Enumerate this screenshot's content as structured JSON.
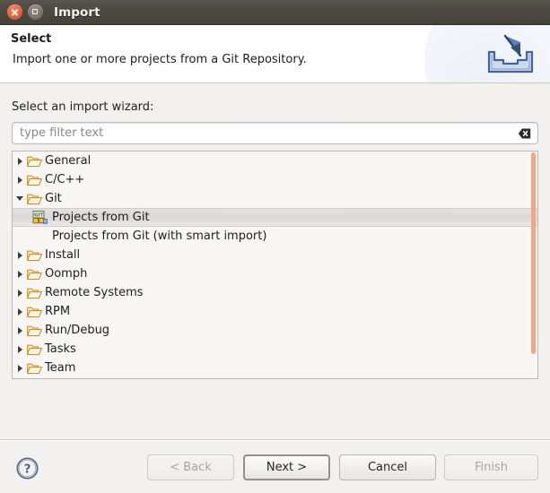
{
  "window": {
    "title": "Import",
    "close_icon": "window-close-icon",
    "maximize_icon": "window-maximize-icon"
  },
  "header": {
    "title": "Select",
    "description": "Import one or more projects from a Git Repository.",
    "icon": "import-wizard-icon"
  },
  "body": {
    "wizard_label": "Select an import wizard:"
  },
  "filter": {
    "placeholder": "type filter text",
    "value": "",
    "clear_icon": "clear-filter-icon"
  },
  "tree": {
    "rows": [
      {
        "label": "General",
        "type": "folder",
        "expanded": false,
        "selected": false
      },
      {
        "label": "C/C++",
        "type": "folder",
        "expanded": false,
        "selected": false
      },
      {
        "label": "Git",
        "type": "folder",
        "expanded": true,
        "selected": false
      },
      {
        "label": "Projects from Git",
        "type": "git",
        "expanded": null,
        "selected": true
      },
      {
        "label": "Projects from Git (with smart import)",
        "type": "leaf",
        "expanded": null,
        "selected": false
      },
      {
        "label": "Install",
        "type": "folder",
        "expanded": false,
        "selected": false
      },
      {
        "label": "Oomph",
        "type": "folder",
        "expanded": false,
        "selected": false
      },
      {
        "label": "Remote Systems",
        "type": "folder",
        "expanded": false,
        "selected": false
      },
      {
        "label": "RPM",
        "type": "folder",
        "expanded": false,
        "selected": false
      },
      {
        "label": "Run/Debug",
        "type": "folder",
        "expanded": false,
        "selected": false
      },
      {
        "label": "Tasks",
        "type": "folder",
        "expanded": false,
        "selected": false
      },
      {
        "label": "Team",
        "type": "folder",
        "expanded": false,
        "selected": false
      }
    ],
    "scrollbar_color": "#eda88c"
  },
  "footer": {
    "help_icon": "help-icon",
    "back_label": "< Back",
    "next_label": "Next >",
    "cancel_label": "Cancel",
    "finish_label": "Finish"
  }
}
